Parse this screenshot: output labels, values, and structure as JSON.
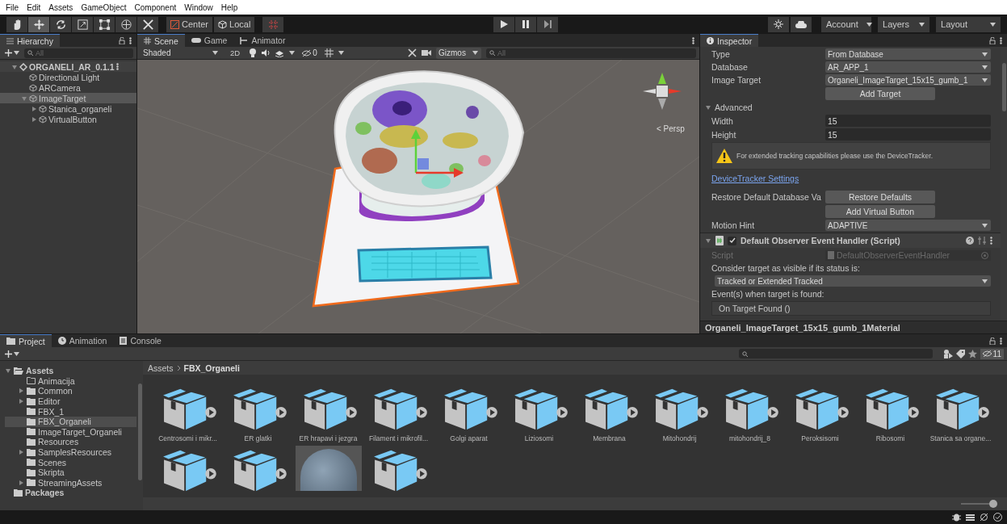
{
  "menu": [
    "File",
    "Edit",
    "Assets",
    "GameObject",
    "Component",
    "Window",
    "Help"
  ],
  "toolbar": {
    "tools": [
      {
        "kind": "hand",
        "selected": false
      },
      {
        "kind": "move",
        "selected": true
      },
      {
        "kind": "rotate",
        "selected": false
      },
      {
        "kind": "scale",
        "selected": false
      },
      {
        "kind": "rect",
        "selected": false
      },
      {
        "kind": "transform",
        "selected": false
      },
      {
        "kind": "custom",
        "selected": false
      }
    ],
    "pivot": "Center",
    "space": "Local",
    "account": "Account",
    "layers": "Layers",
    "layout": "Layout"
  },
  "hierarchy": {
    "tab": "Hierarchy",
    "search_placeholder": "All",
    "items": [
      {
        "name": "ORGANELI_AR_0.1.1",
        "kind": "scene",
        "expanded": true,
        "selected": false,
        "children": [
          {
            "name": "Directional Light",
            "kind": "object",
            "selected": false
          },
          {
            "name": "ARCamera",
            "kind": "object",
            "selected": false
          },
          {
            "name": "ImageTarget",
            "kind": "object",
            "expanded": true,
            "selected": true,
            "children": [
              {
                "name": "Stanica_organeli",
                "kind": "object",
                "expanded": false,
                "selected": false
              },
              {
                "name": "VirtualButton",
                "kind": "object",
                "expanded": false,
                "selected": false
              }
            ]
          }
        ]
      }
    ]
  },
  "scene": {
    "tabs": [
      {
        "label": "Scene",
        "kind": "scene",
        "selected": true
      },
      {
        "label": "Game",
        "kind": "game",
        "selected": false
      },
      {
        "label": "Animator",
        "kind": "animator",
        "selected": false
      }
    ],
    "shading": "Shaded",
    "mode_2d": "2D",
    "hidden_count": "0",
    "gizmos": "Gizmos",
    "search_placeholder": "All",
    "camera_label": "< Persp"
  },
  "inspector": {
    "tab": "Inspector",
    "rows": [
      {
        "kind": "dropdown",
        "label": "Type",
        "value": "From Database"
      },
      {
        "kind": "dropdown",
        "label": "Database",
        "value": "AR_APP_1"
      },
      {
        "kind": "dropdown",
        "label": "Image Target",
        "value": "Organeli_ImageTarget_15x15_gumb_1"
      },
      {
        "kind": "button",
        "text": "Add Target"
      },
      {
        "kind": "foldout",
        "label": "Advanced"
      },
      {
        "kind": "field",
        "label": "Width",
        "value": "15"
      },
      {
        "kind": "field",
        "label": "Height",
        "value": "15"
      },
      {
        "kind": "warning",
        "text": "For extended tracking capabilities please use the DeviceTracker."
      },
      {
        "kind": "link",
        "text": "DeviceTracker Settings"
      },
      {
        "kind": "button",
        "label": "Restore Default Database Va",
        "text": "Restore Defaults"
      },
      {
        "kind": "button",
        "text": "Add Virtual Button"
      },
      {
        "kind": "dropdown",
        "label": "Motion Hint",
        "value": "ADAPTIVE"
      },
      {
        "kind": "component",
        "text": "Default Observer Event Handler (Script)",
        "checked": true
      },
      {
        "kind": "object",
        "label": "Script",
        "value": "DefaultObserverEventHandler"
      },
      {
        "kind": "text",
        "text": "Consider target as visible if its status is:"
      },
      {
        "kind": "dropdown",
        "value": "Tracked or Extended Tracked"
      },
      {
        "kind": "text",
        "text": "Event(s) when target is found:"
      },
      {
        "kind": "event",
        "text": "On Target Found ()"
      }
    ],
    "preview_title": "Organeli_ImageTarget_15x15_gumb_1Material"
  },
  "project": {
    "tabs": [
      {
        "label": "Project",
        "kind": "project",
        "selected": true
      },
      {
        "label": "Animation",
        "kind": "animation",
        "selected": false
      },
      {
        "label": "Console",
        "kind": "console",
        "selected": false
      }
    ],
    "hidden_count": "11",
    "breadcrumb": [
      "Assets",
      "FBX_Organeli"
    ],
    "folders": [
      {
        "name": "Assets",
        "expanded": true,
        "empty": false,
        "selected": false,
        "children": [
          {
            "name": "Animacija",
            "empty": true,
            "selected": false
          },
          {
            "name": "Common",
            "expanded": false,
            "empty": false,
            "selected": false
          },
          {
            "name": "Editor",
            "expanded": false,
            "empty": false,
            "selected": false
          },
          {
            "name": "FBX_1",
            "empty": false,
            "selected": false
          },
          {
            "name": "FBX_Organeli",
            "empty": false,
            "selected": true
          },
          {
            "name": "ImageTarget_Organeli",
            "empty": false,
            "selected": false
          },
          {
            "name": "Resources",
            "empty": false,
            "selected": false
          },
          {
            "name": "SamplesResources",
            "expanded": false,
            "empty": false,
            "selected": false
          },
          {
            "name": "Scenes",
            "empty": false,
            "selected": false
          },
          {
            "name": "Skripta",
            "empty": false,
            "selected": false
          },
          {
            "name": "StreamingAssets",
            "expanded": false,
            "empty": false,
            "selected": false
          }
        ]
      },
      {
        "name": "Packages",
        "empty": false,
        "selected": false
      }
    ],
    "assets": [
      {
        "kind": "model",
        "name": "Centrosomi i mikr..."
      },
      {
        "kind": "model",
        "name": "ER glatki"
      },
      {
        "kind": "model",
        "name": "ER hrapavi i jezgra"
      },
      {
        "kind": "model",
        "name": "Filament i mikrofil..."
      },
      {
        "kind": "model",
        "name": "Golgi aparat"
      },
      {
        "kind": "model",
        "name": "Liziosomi"
      },
      {
        "kind": "model",
        "name": "Membrana"
      },
      {
        "kind": "model",
        "name": "Mitohondrij"
      },
      {
        "kind": "model",
        "name": "mitohondrij_8"
      },
      {
        "kind": "model",
        "name": "Peroksisomi"
      },
      {
        "kind": "model",
        "name": "Ribosomi"
      },
      {
        "kind": "model",
        "name": "Stanica sa organe..."
      },
      {
        "kind": "model"
      },
      {
        "kind": "model"
      },
      {
        "kind": "material"
      },
      {
        "kind": "model"
      }
    ],
    "icon_size": {
      "level": 1
    }
  }
}
